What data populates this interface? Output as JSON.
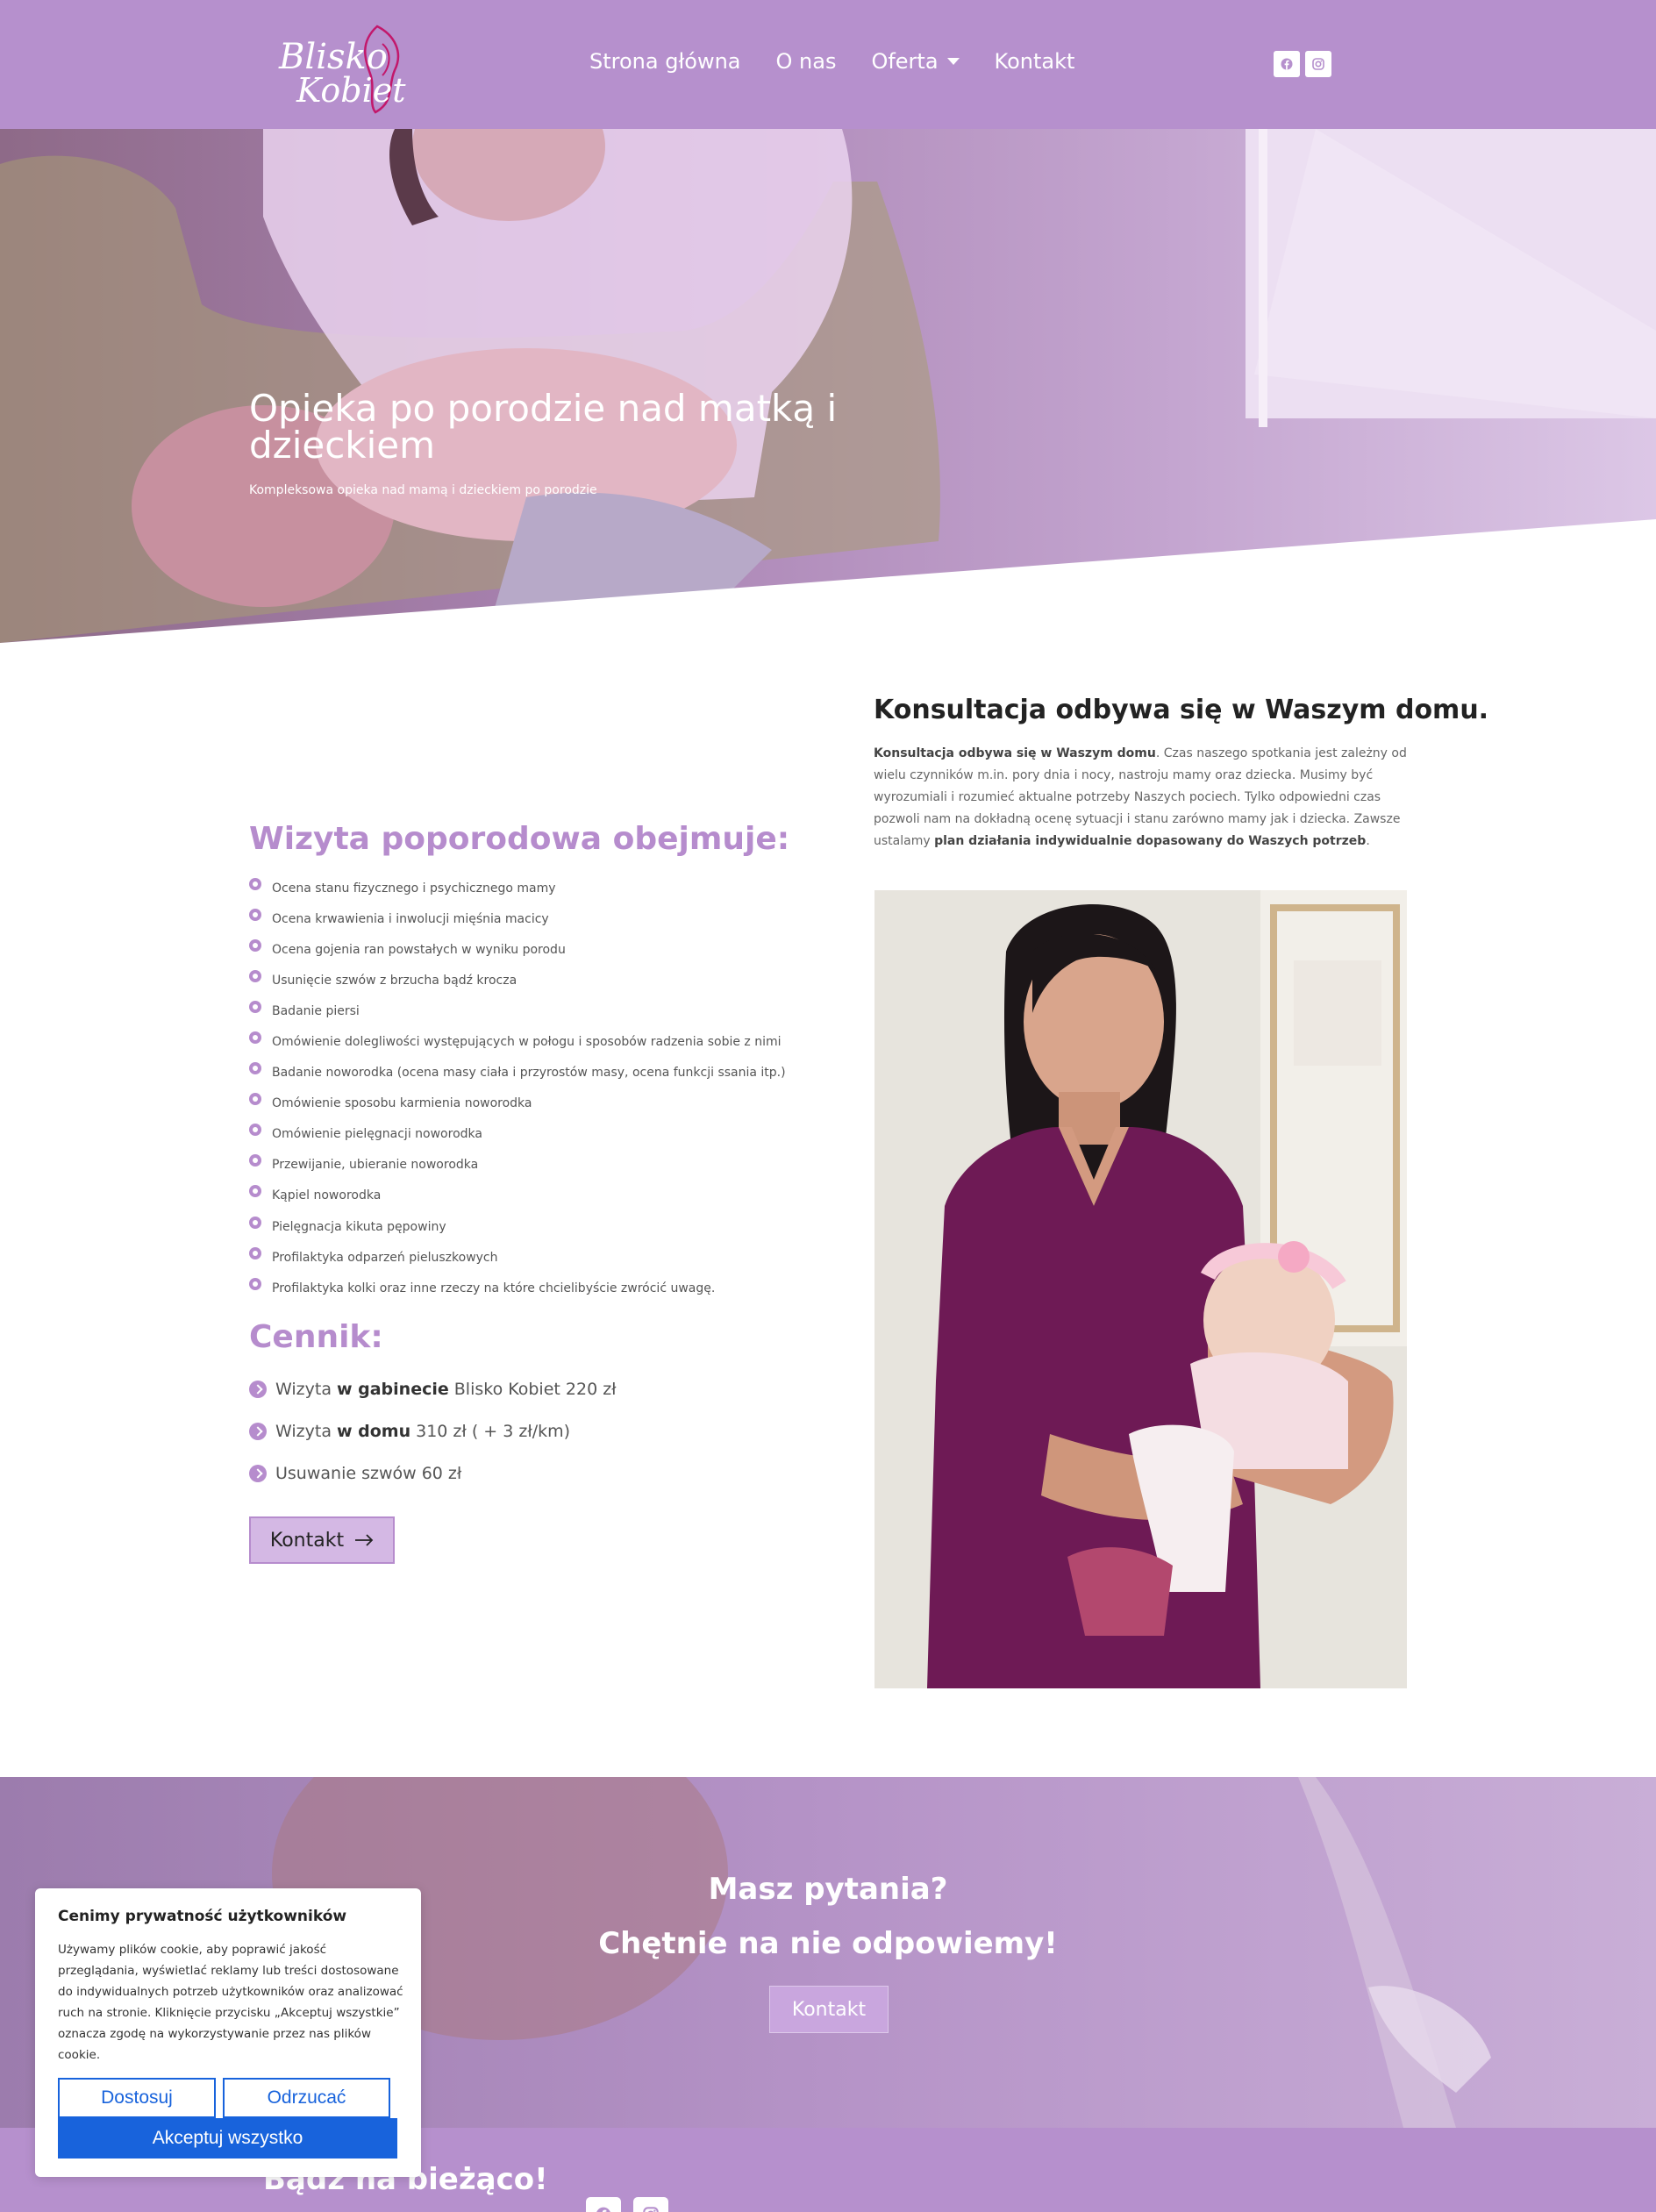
{
  "header": {
    "logo_text_line1": "Blisko",
    "logo_text_line2": "Kobiet",
    "nav": [
      "Strona główna",
      "O nas",
      "Oferta",
      "Kontakt"
    ],
    "social": [
      "facebook-icon",
      "instagram-icon"
    ]
  },
  "hero": {
    "title": "Opieka po porodzie nad matką i dzieckiem",
    "subtitle": "Kompleksowa opieka nad mamą i dzieckiem po porodzie"
  },
  "visit": {
    "title": "Wizyta poporodowa obejmuje:",
    "items": [
      "Ocena stanu fizycznego i psychicznego mamy",
      "Ocena krwawienia i inwolucji mięśnia macicy",
      "Ocena gojenia ran powstałych w wyniku porodu",
      "Usunięcie szwów z brzucha bądź krocza",
      "Badanie piersi",
      "Omówienie dolegliwości występujących w połogu i sposobów radzenia sobie z nimi",
      "Badanie noworodka (ocena masy ciała i przyrostów masy, ocena funkcji ssania itp.)",
      "Omówienie sposobu karmienia noworodka",
      "Omówienie pielęgnacji noworodka",
      "Przewijanie, ubieranie noworodka",
      "Kąpiel noworodka",
      "Pielęgnacja kikuta pępowiny",
      "Profilaktyka odparzeń pieluszkowych",
      "Profilaktyka kolki oraz inne rzeczy na które chcielibyście zwrócić uwagę."
    ]
  },
  "pricing": {
    "title": "Cennik:",
    "items": [
      {
        "prefix": "Wizyta",
        "bold": "w gabinecie",
        "suffix": "Blisko Kobiet 220 zł"
      },
      {
        "prefix": "Wizyta",
        "bold": "w domu",
        "suffix": "310 zł ( + 3 zł/km)"
      },
      {
        "prefix": "Usuwanie szwów 60 zł",
        "bold": "",
        "suffix": ""
      }
    ],
    "button": "Kontakt"
  },
  "consult": {
    "title": "Konsultacja odbywa się w Waszym domu.",
    "lead_bold": "Konsultacja odbywa się w Waszym domu",
    "text": ". Czas naszego spotkania jest zależny od wielu czynników m.in. pory dnia i nocy, nastroju mamy oraz dziecka.  Musimy być wyrozumiali i rozumieć aktualne potrzeby Naszych pociech. Tylko odpowiedni czas pozwoli nam na dokładną ocenę sytuacji i stanu zarówno mamy jak i dziecka. Zawsze ustalamy ",
    "tail_bold": "plan działania indywidualnie dopasowany do Waszych potrzeb",
    "tail": "."
  },
  "cta": {
    "line1": "Masz pytania?",
    "line2": "Chętnie na nie odpowiemy!",
    "button": "Kontakt"
  },
  "footer": {
    "title": "Bądź na bieżąco!"
  },
  "cookie": {
    "title": "Cenimy prywatność użytkowników",
    "text": "Używamy plików cookie, aby poprawić jakość przeglądania, wyświetlać reklamy lub treści dostosowane do indywidualnych potrzeb użytkowników oraz analizować ruch na stronie. Kliknięcie przycisku „Akceptuj wszystkie” oznacza zgodę na wykorzystywanie przez nas plików cookie.",
    "customize": "Dostosuj",
    "reject": "Odrzucać",
    "accept": "Akceptuj wszystko"
  },
  "colors": {
    "brand_purple": "#b690cd",
    "accent_purple": "#b68ccd",
    "cookie_blue": "#1863dc"
  }
}
